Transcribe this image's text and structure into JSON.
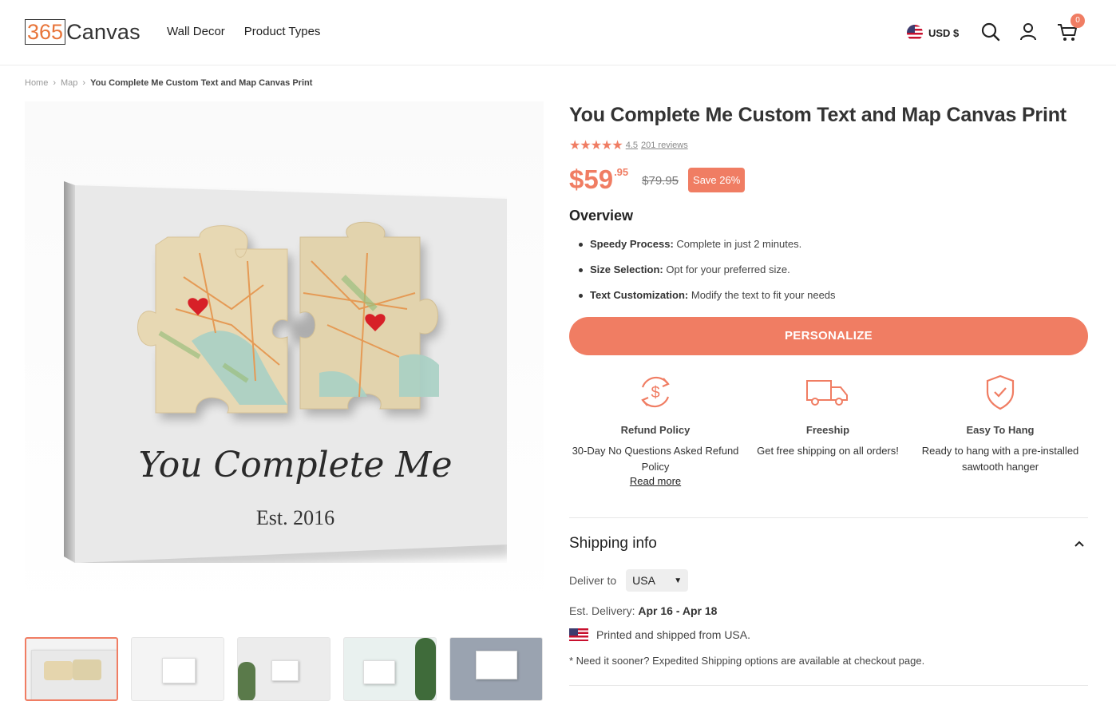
{
  "header": {
    "logo_number": "365",
    "logo_text": "Canvas",
    "nav": [
      "Wall Decor",
      "Product Types"
    ],
    "currency": "USD $",
    "cart_count": "0"
  },
  "breadcrumb": {
    "home": "Home",
    "category": "Map",
    "current": "You Complete Me Custom Text and Map Canvas Print"
  },
  "product": {
    "image_text_line1": "You Complete Me",
    "image_text_line2": "Est. 2016",
    "title": "You Complete Me Custom Text and Map Canvas Print",
    "rating": "4.5",
    "reviews": "201 reviews",
    "price_main": "$59",
    "price_cents": ".95",
    "old_price": "$79.95",
    "save": "Save 26%"
  },
  "overview": {
    "heading": "Overview",
    "items": [
      {
        "label": "Speedy Process:",
        "text": " Complete in just 2 minutes."
      },
      {
        "label": "Size Selection:",
        "text": " Opt for your preferred size."
      },
      {
        "label": "Text Customization:",
        "text": " Modify the text to fit your needs"
      }
    ]
  },
  "cta": {
    "personalize": "PERSONALIZE"
  },
  "features": [
    {
      "icon": "refund-icon",
      "title": "Refund Policy",
      "text": "30-Day No Questions Asked Refund Policy",
      "link": "Read more"
    },
    {
      "icon": "truck-icon",
      "title": "Freeship",
      "text": "Get free shipping on all orders!"
    },
    {
      "icon": "shield-check-icon",
      "title": "Easy To Hang",
      "text": "Ready to hang with a pre-installed sawtooth hanger"
    }
  ],
  "shipping": {
    "heading": "Shipping info",
    "deliver_label": "Deliver to",
    "country": "USA",
    "est_label": "Est. Delivery:",
    "est_dates": "Apr 16 - Apr 18",
    "shipped_from": "Printed and shipped from USA.",
    "note": "* Need it sooner? Expedited Shipping options are available at checkout page."
  },
  "colors": {
    "accent": "#f07d63",
    "logo_orange": "#e8753a",
    "text": "#333333"
  }
}
